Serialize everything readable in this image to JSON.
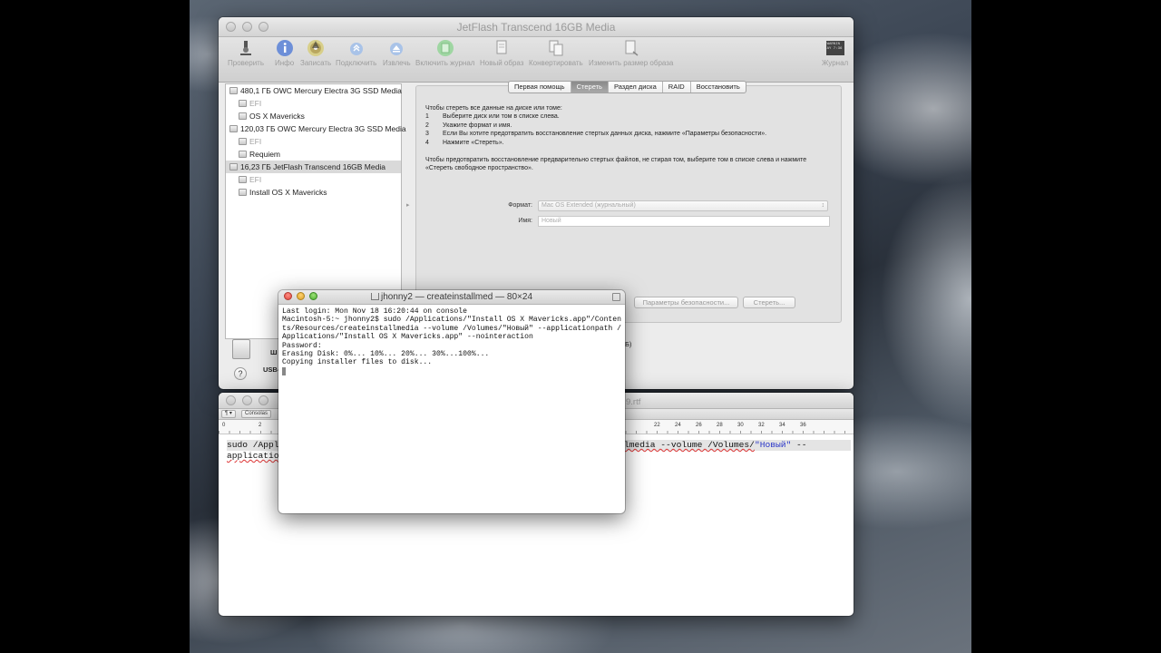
{
  "disk_utility": {
    "title": "JetFlash Transcend 16GB Media",
    "toolbar": [
      {
        "label": "Проверить",
        "icon": "microscope-icon"
      },
      {
        "label": "Инфо",
        "icon": "info-icon"
      },
      {
        "label": "Записать",
        "icon": "burn-icon"
      },
      {
        "label": "Подключить",
        "icon": "mount-icon"
      },
      {
        "label": "Извлечь",
        "icon": "eject-icon"
      },
      {
        "label": "Включить журнал",
        "icon": "journal-icon"
      },
      {
        "label": "Новый образ",
        "icon": "new-image-icon"
      },
      {
        "label": "Конвертировать",
        "icon": "convert-icon"
      },
      {
        "label": "Изменить размер образа",
        "icon": "resize-image-icon"
      },
      {
        "label": "Журнал",
        "icon": "log-icon"
      }
    ],
    "log_icon_text": "WARNIN\nAY 7:36",
    "sidebar": [
      {
        "label": "480,1 ГБ OWC Mercury Electra 3G SSD Media",
        "level": 0
      },
      {
        "label": "EFI",
        "level": 1,
        "dim": true
      },
      {
        "label": "OS X Mavericks",
        "level": 1
      },
      {
        "label": "120,03 ГБ OWC Mercury Electra 3G SSD Media",
        "level": 0
      },
      {
        "label": "EFI",
        "level": 1,
        "dim": true
      },
      {
        "label": "Requiem",
        "level": 1
      },
      {
        "label": "16,23 ГБ JetFlash Transcend 16GB Media",
        "level": 0,
        "selected": true
      },
      {
        "label": "EFI",
        "level": 1,
        "dim": true
      },
      {
        "label": "Install OS X Mavericks",
        "level": 1
      }
    ],
    "tabs": [
      "Первая помощь",
      "Стереть",
      "Раздел диска",
      "RAID",
      "Восстановить"
    ],
    "active_tab": "Стереть",
    "help_intro": "Чтобы стереть все данные на диске или томе:",
    "help_steps": [
      {
        "n": "1",
        "text": "Выберите диск или том в списке слева."
      },
      {
        "n": "2",
        "text": "Укажите формат и имя."
      },
      {
        "n": "3",
        "text": "Если Вы хотите предотвратить восстановление стертых данных диска, нажмите «Параметры безопасности»."
      },
      {
        "n": "4",
        "text": "Нажмите «Стереть»."
      }
    ],
    "help_extra": "Чтобы предотвратить восстановление предварительно стертых файлов, не стирая том, выберите том в списке слева и нажмите «Стереть свободное пространство».",
    "format_label": "Формат:",
    "format_value": "Mac OS Extended (журнальный)",
    "name_label": "Имя:",
    "name_placeholder": "Новый",
    "security_button": "Параметры безопасности...",
    "erase_button": "Стереть...",
    "bottom_label_1": "Ш",
    "bottom_label_2": "USB-",
    "bottom_label_3": "Б)",
    "help_symbol": "?"
  },
  "terminal": {
    "title": "jhonny2 — createinstallmed — 80×24",
    "lines": [
      "Last login: Mon Nov 18 16:20:44 on console",
      "Macintosh-5:~ jhonny2$ sudo /Applications/\"Install OS X Mavericks.app\"/Contents/Resources/createinstallmedia --volume /Volumes/\"Новый\" --applicationpath /Applications/\"Install OS X Mavericks.app\" --nointeraction",
      "Password:",
      "Erasing Disk: 0%... 10%... 20%... 30%...100%...",
      "Copying installer files to disk..."
    ]
  },
  "textedit": {
    "title_fragment": "9.rtf",
    "styles_button": "¶",
    "consolas_button": "Consolas",
    "ruler_ticks": [
      "0",
      "2",
      "22",
      "24",
      "26",
      "28",
      "30",
      "32",
      "34",
      "36"
    ],
    "line1_left": "sudo /Appl",
    "line2_left": "applicatio",
    "line1_right_prefix": "lmedia --volume /Volumes/",
    "line1_right_volume": "\"Новый\"",
    "line1_right_suffix": " --"
  }
}
